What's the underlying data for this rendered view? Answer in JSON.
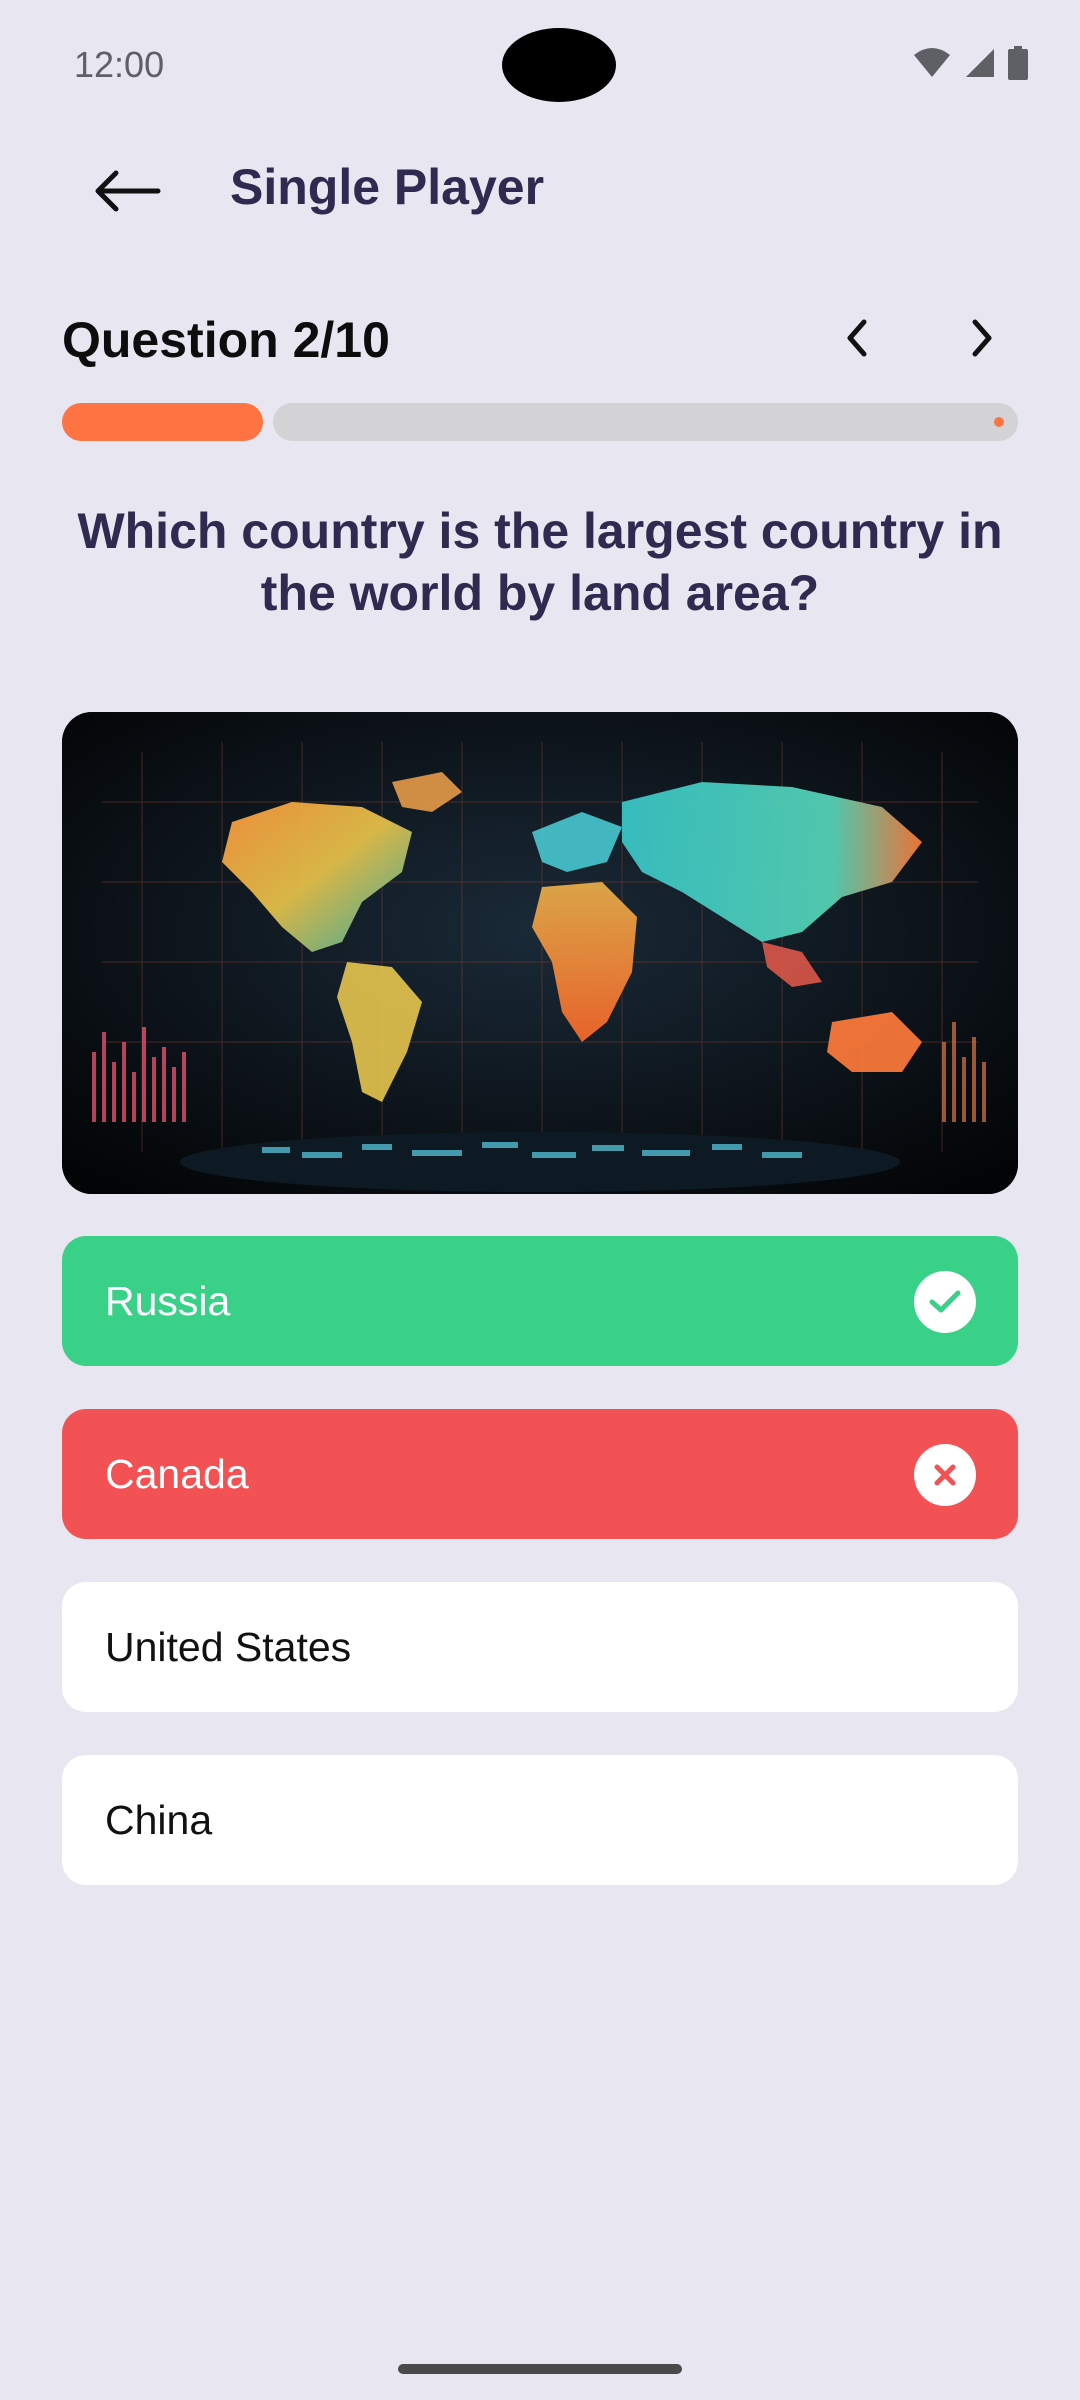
{
  "status_bar": {
    "time": "12:00"
  },
  "app_bar": {
    "title": "Single Player",
    "back_icon": "arrow-left-icon"
  },
  "quiz": {
    "question_label": "Question 2/10",
    "current": 2,
    "total": 10,
    "progress_fraction": 0.2,
    "question": "Which country is the largest country in the world by land area?",
    "image": "world-map-illustration"
  },
  "answers": [
    {
      "label": "Russia",
      "state": "correct",
      "icon": "check-icon"
    },
    {
      "label": "Canada",
      "state": "wrong",
      "icon": "close-icon"
    },
    {
      "label": "United States",
      "state": "neutral"
    },
    {
      "label": "China",
      "state": "neutral"
    }
  ],
  "colors": {
    "background": "#e8e6f1",
    "accent": "#ff7442",
    "title": "#2f2a4f",
    "correct": "#39d188",
    "wrong": "#f35254",
    "track": "#d3d2d5"
  }
}
